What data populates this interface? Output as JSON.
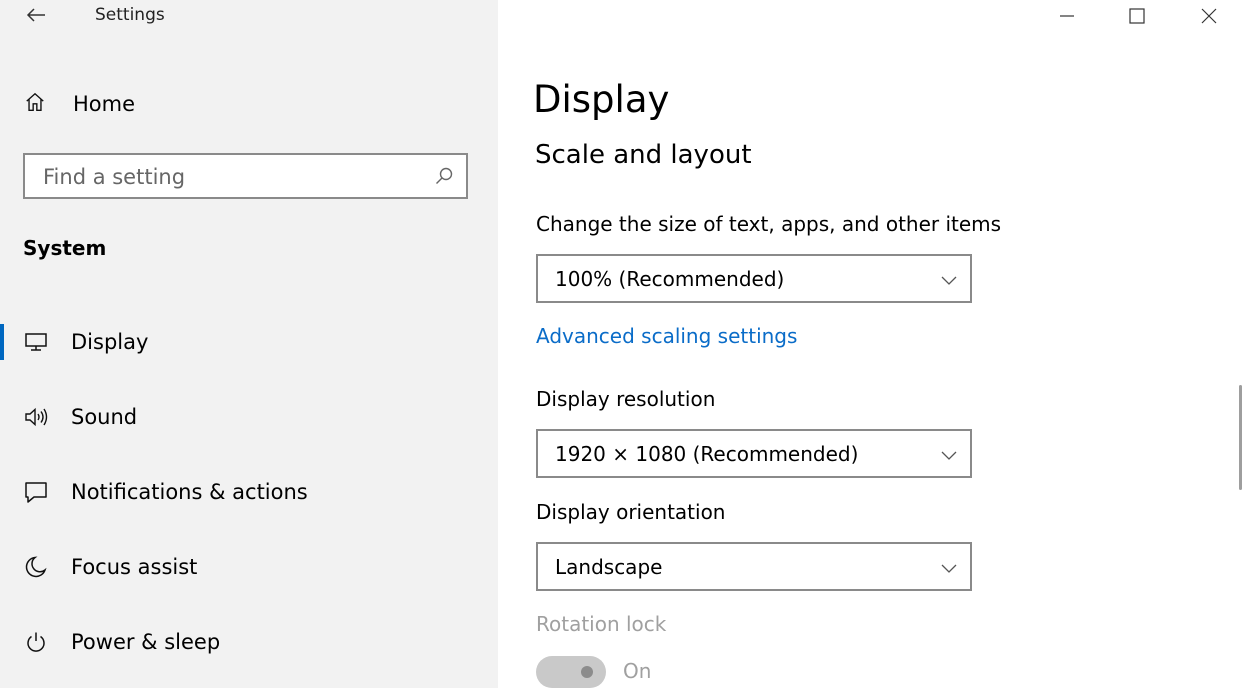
{
  "window": {
    "title": "Settings",
    "controls": {
      "minimize": "minimize",
      "maximize": "maximize",
      "close": "close"
    }
  },
  "sidebar": {
    "home_label": "Home",
    "search": {
      "placeholder": "Find a setting",
      "value": ""
    },
    "section_heading": "System",
    "items": [
      {
        "label": "Display",
        "icon": "monitor-icon",
        "selected": true
      },
      {
        "label": "Sound",
        "icon": "speaker-icon",
        "selected": false
      },
      {
        "label": "Notifications & actions",
        "icon": "notification-icon",
        "selected": false
      },
      {
        "label": "Focus assist",
        "icon": "moon-icon",
        "selected": false
      },
      {
        "label": "Power & sleep",
        "icon": "power-icon",
        "selected": false
      }
    ]
  },
  "main": {
    "page_title": "Display",
    "section_title": "Scale and layout",
    "scale": {
      "label": "Change the size of text, apps, and other items",
      "value": "100% (Recommended)"
    },
    "advanced_link": "Advanced scaling settings",
    "resolution": {
      "label": "Display resolution",
      "value": "1920 × 1080 (Recommended)"
    },
    "orientation": {
      "label": "Display orientation",
      "value": "Landscape"
    },
    "rotation_lock": {
      "label": "Rotation lock",
      "state": "On",
      "enabled": false
    }
  },
  "colors": {
    "accent": "#0067c0",
    "link": "#0a6cc8",
    "sidebar_bg": "#f2f2f2",
    "disabled_text": "#a0a0a0"
  }
}
